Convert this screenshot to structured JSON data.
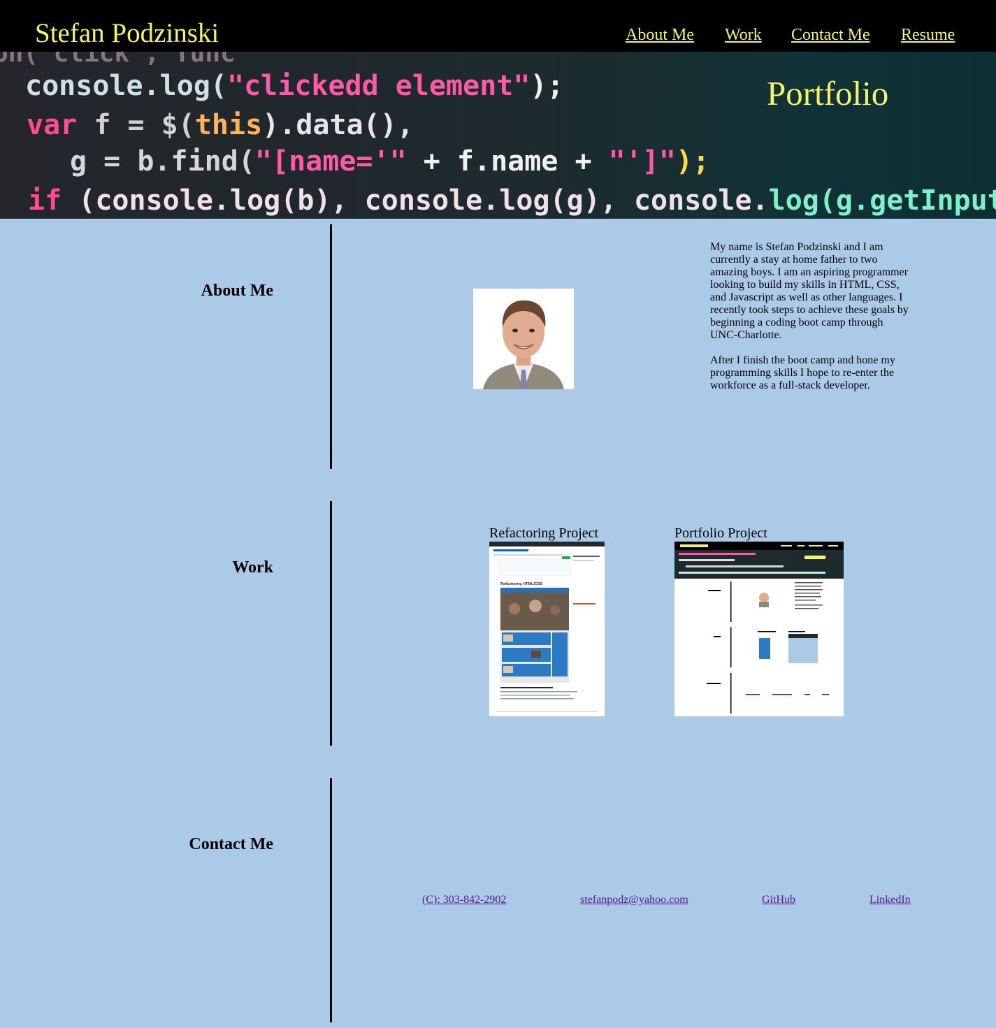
{
  "header": {
    "brand": "Stefan Podzinski",
    "nav": [
      "About Me",
      "Work",
      "Contact Me",
      "Resume"
    ]
  },
  "hero": {
    "title": "Portfolio",
    "code_lines": [
      "on(\"click\", func",
      "console.log(\"clickedd element\");",
      "var f = $(this).data(),",
      "g = b.find(\"[name='\" + f.name + \"']\");",
      "if (console.log(b), console.log(g), console.log(g.getInput"
    ]
  },
  "about": {
    "title": "About Me",
    "bio_1": "My name is Stefan Podzinski and I am currently a stay at home father to two amazing boys. I am an aspiring programmer looking to build my skills in HTML, CSS, and Javascript as well as other languages. I recently took steps to achieve these goals by beginning a coding boot camp through UNC-Charlotte.",
    "bio_2": "After I finish the boot camp and hone my programming skills I hope to re-enter the workforce as a full-stack developer."
  },
  "work": {
    "title": "Work",
    "projects": [
      {
        "title": "Refactoring Project",
        "thumb_heading": "Refactoring HTML/CSS"
      },
      {
        "title": "Portfolio Project"
      }
    ]
  },
  "contact": {
    "title": "Contact Me",
    "links": [
      "(C): 303-842-2902",
      "stefanpodz@yahoo.com",
      "GitHub",
      "LinkedIn"
    ]
  },
  "colors": {
    "accent_yellow": "#f5f36b",
    "page_background": "#abcae8",
    "link_visited": "#551a8b"
  }
}
